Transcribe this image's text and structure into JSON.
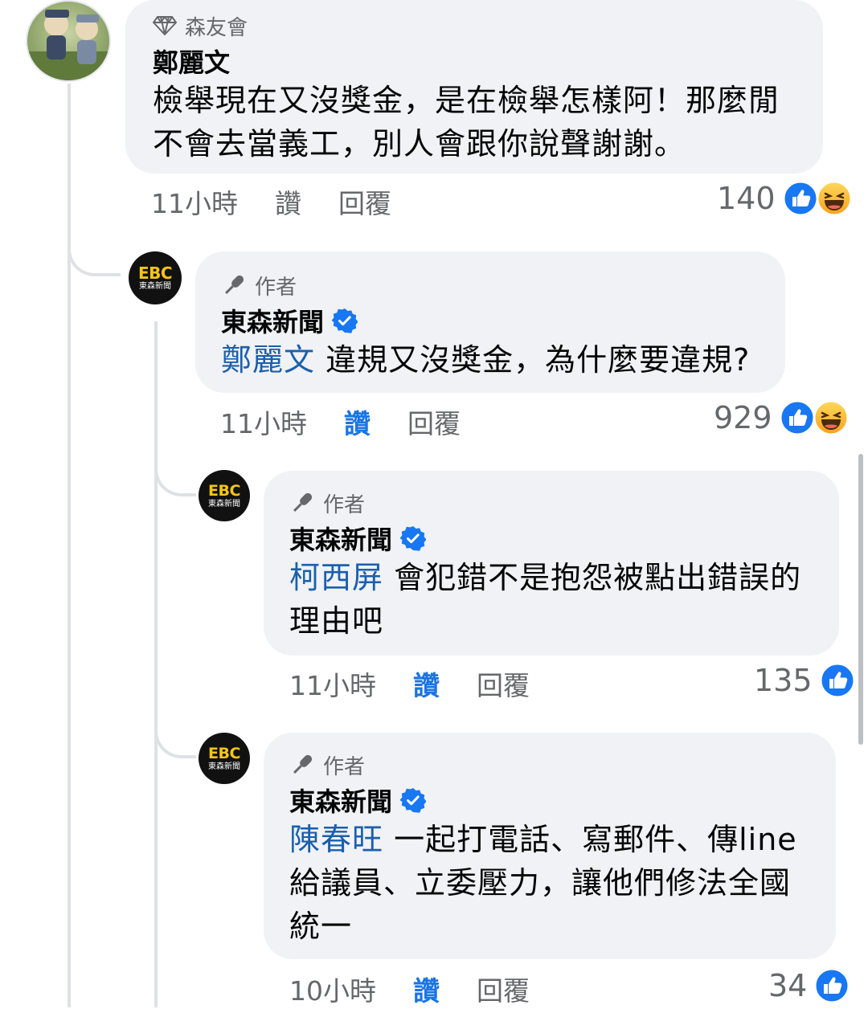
{
  "comments": [
    {
      "badge": "森友會",
      "author": "鄭麗文",
      "mention": "",
      "text": "檢舉現在又沒獎金，是在檢舉怎樣阿！那麼閒不會去當義工，別人會跟你說聲謝謝。",
      "time": "11小時",
      "like": "讚",
      "reply": "回覆",
      "reaction_count": "140",
      "reactions": [
        "like-icon",
        "haha-icon"
      ],
      "liked_by_me": false
    },
    {
      "badge": "作者",
      "author": "東森新聞",
      "mention": "鄭麗文",
      "text": "違規又沒獎金，為什麼要違規?",
      "time": "11小時",
      "like": "讚",
      "reply": "回覆",
      "reaction_count": "929",
      "reactions": [
        "like-icon",
        "haha-icon"
      ],
      "liked_by_me": true
    },
    {
      "badge": "作者",
      "author": "東森新聞",
      "mention": "柯西屏",
      "text": "會犯錯不是抱怨被點出錯誤的理由吧",
      "time": "11小時",
      "like": "讚",
      "reply": "回覆",
      "reaction_count": "135",
      "reactions": [
        "like-icon"
      ],
      "liked_by_me": true
    },
    {
      "badge": "作者",
      "author": "東森新聞",
      "mention": "陳春旺",
      "text": "一起打電話、寫郵件、傳line給議員、立委壓力，讓他們修法全國統一",
      "time": "10小時",
      "like": "讚",
      "reply": "回覆",
      "reaction_count": "34",
      "reactions": [
        "like-icon"
      ],
      "liked_by_me": true
    }
  ],
  "ebc_logo": {
    "mark": "EBC",
    "sub": "東森新聞"
  },
  "colors": {
    "bubble": "#f0f2f5",
    "mention": "#1b5fad",
    "liked": "#1b74e4",
    "like_icon": "#1877f2",
    "haha_icon": "#f7b125",
    "meta": "#65676b"
  }
}
